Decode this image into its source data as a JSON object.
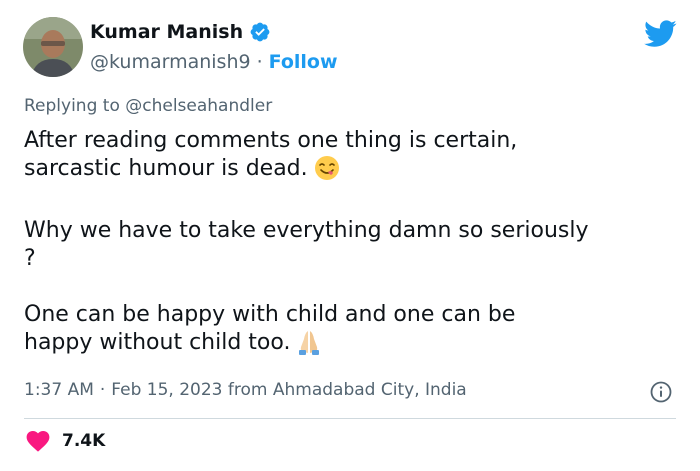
{
  "author": {
    "display_name": "Kumar Manish",
    "handle": "@kumarmanish9",
    "separator": "·",
    "follow_label": "Follow"
  },
  "reply": {
    "prefix": "Replying to",
    "mention": "@chelseahandler"
  },
  "tweet": {
    "line1": "After reading comments one thing is certain,",
    "line2": "sarcastic humour is dead.",
    "line3": "Why we have to take everything damn so seriously",
    "line4": "?",
    "line5": "One can be happy with child and one can be",
    "line6": "happy without child too."
  },
  "meta": {
    "time": "1:37 AM",
    "separator": "·",
    "date": "Feb 15, 2023",
    "location_text": "from Ahmadabad City, India"
  },
  "engagement": {
    "likes": "7.4K"
  },
  "colors": {
    "accent": "#1d9bf0",
    "like": "#f91880",
    "text_primary": "#0f1419",
    "text_secondary": "#536471"
  },
  "icons": {
    "verified": "verified-badge-icon",
    "brand": "twitter-bird-icon",
    "emoji1": "face-savoring-food-emoji",
    "emoji2": "folded-hands-emoji",
    "info": "info-icon",
    "like": "heart-icon"
  }
}
